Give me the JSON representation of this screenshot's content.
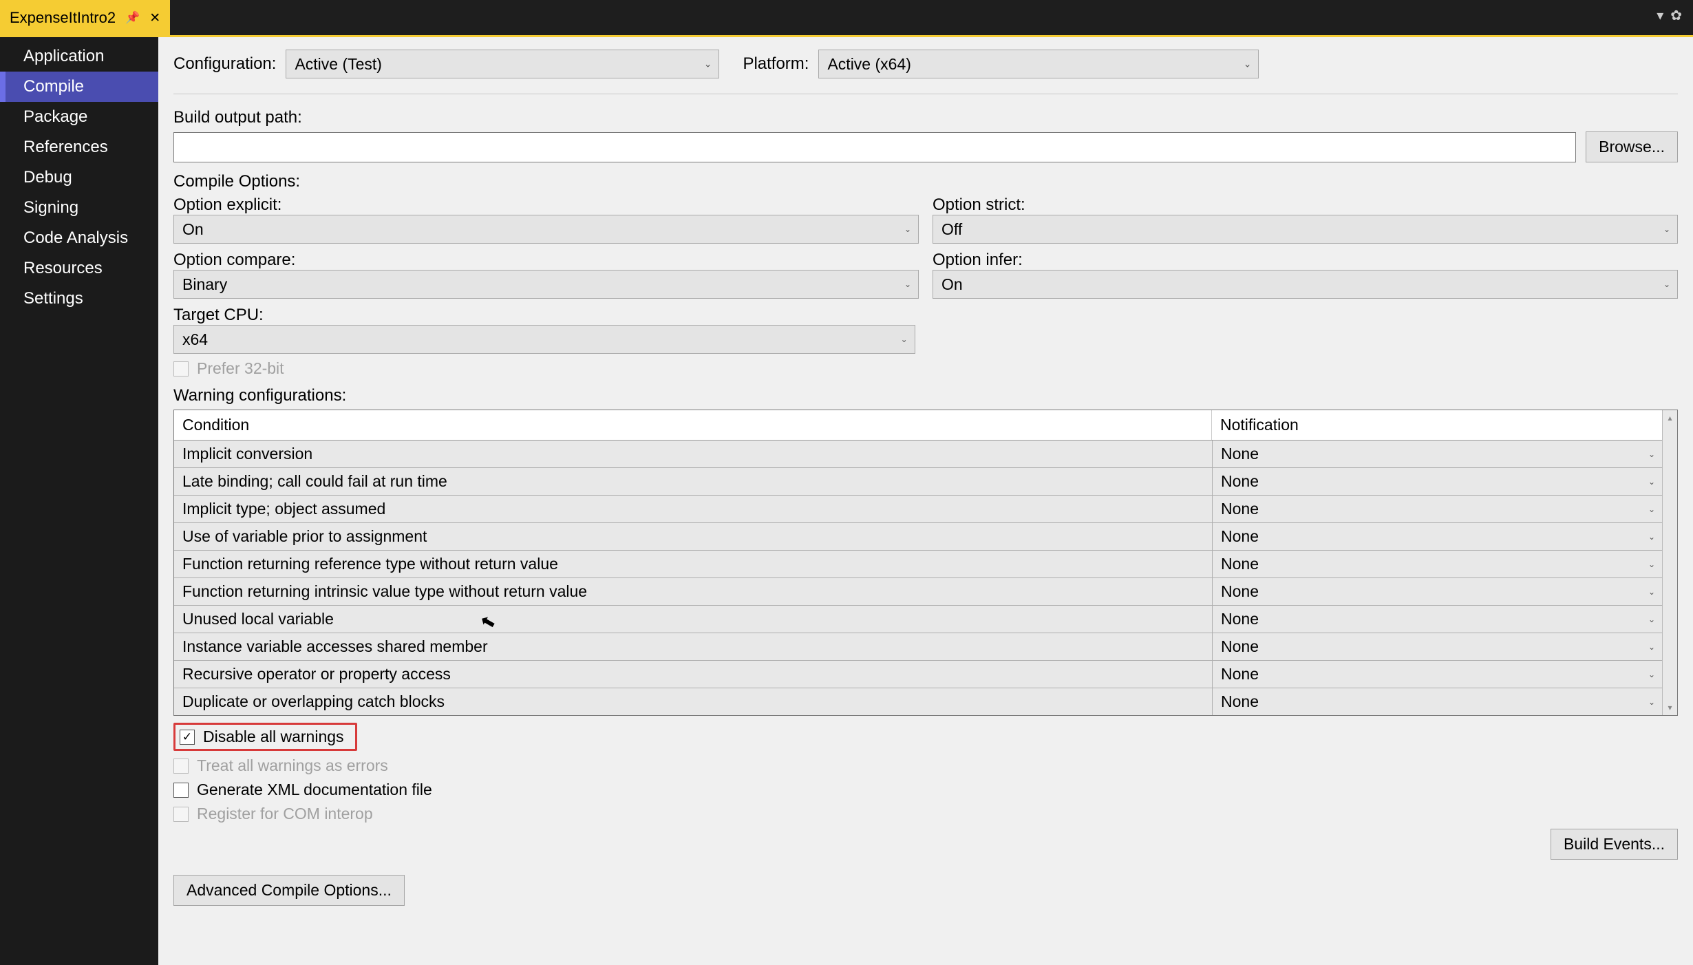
{
  "tab": {
    "title": "ExpenseItIntro2"
  },
  "sidebar": {
    "items": [
      {
        "label": "Application"
      },
      {
        "label": "Compile",
        "selected": true
      },
      {
        "label": "Package"
      },
      {
        "label": "References"
      },
      {
        "label": "Debug"
      },
      {
        "label": "Signing"
      },
      {
        "label": "Code Analysis"
      },
      {
        "label": "Resources"
      },
      {
        "label": "Settings"
      }
    ]
  },
  "config": {
    "configuration_label": "Configuration:",
    "configuration_value": "Active (Test)",
    "platform_label": "Platform:",
    "platform_value": "Active (x64)"
  },
  "build_output": {
    "label": "Build output path:",
    "value": "",
    "browse": "Browse..."
  },
  "compile_options": {
    "heading": "Compile Options:",
    "option_explicit_label": "Option explicit:",
    "option_explicit_value": "On",
    "option_strict_label": "Option strict:",
    "option_strict_value": "Off",
    "option_compare_label": "Option compare:",
    "option_compare_value": "Binary",
    "option_infer_label": "Option infer:",
    "option_infer_value": "On",
    "target_cpu_label": "Target CPU:",
    "target_cpu_value": "x64",
    "prefer_32_label": "Prefer 32-bit"
  },
  "warnings": {
    "heading": "Warning configurations:",
    "col_condition": "Condition",
    "col_notification": "Notification",
    "rows": [
      {
        "condition": "Implicit conversion",
        "notification": "None"
      },
      {
        "condition": "Late binding; call could fail at run time",
        "notification": "None"
      },
      {
        "condition": "Implicit type; object assumed",
        "notification": "None"
      },
      {
        "condition": "Use of variable prior to assignment",
        "notification": "None"
      },
      {
        "condition": "Function returning reference type without return value",
        "notification": "None"
      },
      {
        "condition": "Function returning intrinsic value type without return value",
        "notification": "None"
      },
      {
        "condition": "Unused local variable",
        "notification": "None"
      },
      {
        "condition": "Instance variable accesses shared member",
        "notification": "None"
      },
      {
        "condition": "Recursive operator or property access",
        "notification": "None"
      },
      {
        "condition": "Duplicate or overlapping catch blocks",
        "notification": "None"
      }
    ]
  },
  "checks": {
    "disable_all": "Disable all warnings",
    "treat_errors": "Treat all warnings as errors",
    "gen_xml": "Generate XML documentation file",
    "com_interop": "Register for COM interop"
  },
  "buttons": {
    "build_events": "Build Events...",
    "advanced": "Advanced Compile Options..."
  }
}
